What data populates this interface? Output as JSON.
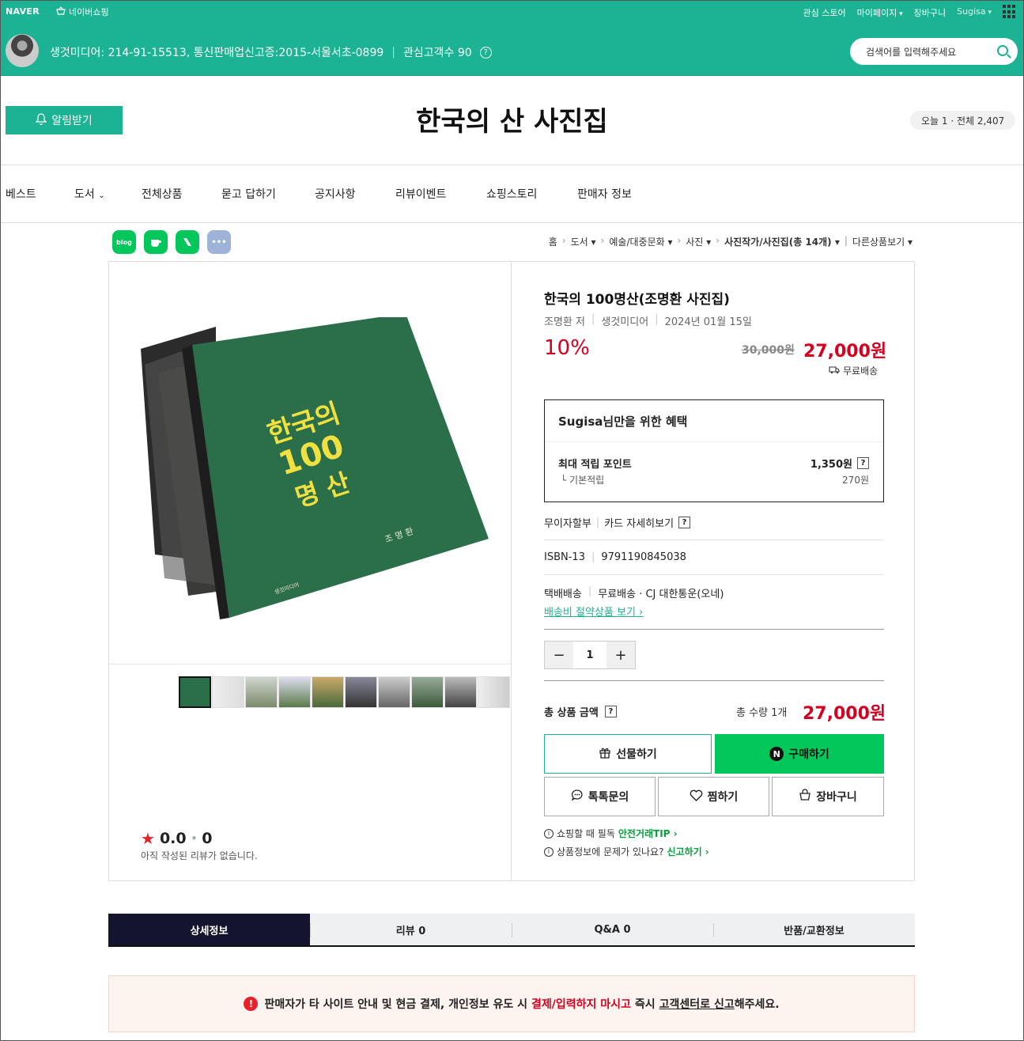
{
  "topbar": {
    "logo": "NAVER",
    "shopping": "네이버쇼핑",
    "links": [
      "관심 스토어",
      "마이페이지",
      "장바구니",
      "Sugisa"
    ],
    "seller_info": "생것미디어: 214-91-15513, 통신판매업신고증:2015-서울서초-0899",
    "followers": "관심고객수 90",
    "search_placeholder": "검색어를 입력해주세요"
  },
  "header": {
    "alarm_button": "알림받기",
    "store_title": "한국의 산 사진집",
    "visitors": "오늘 1 · 전체 2,407"
  },
  "nav": [
    "베스트",
    "도서",
    "전체상품",
    "묻고 답하기",
    "공지사항",
    "리뷰이벤트",
    "쇼핑스토리",
    "판매자 정보"
  ],
  "share": [
    "blog"
  ],
  "breadcrumb": [
    "홈",
    "도서",
    "예술/대중문화",
    "사진",
    "사진작가/사진집(총 14개)",
    "다른상품보기"
  ],
  "product": {
    "title": "한국의 100명산(조명환 사진집)",
    "author": "조명환 저",
    "publisher": "생것미디어",
    "date": "2024년 01월 15일",
    "discount": "10%",
    "original_price": "30,000원",
    "sale_price": "27,000원",
    "shipping_badge": "무료배송",
    "cover_title_1": "한국의",
    "cover_title_2": "100",
    "cover_title_3": "명 산",
    "cover_author": "조 명 환",
    "cover_publisher": "생것미디어"
  },
  "benefit": {
    "user": "Sugisa",
    "heading_suffix": "님만을 위한 혜택",
    "max_point_label": "최대 적립 포인트",
    "max_point_value": "1,350원",
    "base_label": "기본적립",
    "base_value": "270원"
  },
  "installment": {
    "label": "무이자할부",
    "card_link": "카드 자세히보기"
  },
  "isbn": {
    "label": "ISBN-13",
    "value": "9791190845038"
  },
  "shipping": {
    "label": "택배배송",
    "value": "무료배송 · CJ 대한통운(오네)",
    "link": "배송비 절약상품 보기"
  },
  "quantity": {
    "value": "1"
  },
  "total": {
    "label": "총 상품 금액",
    "qty": "총 수량 1개",
    "price": "27,000원"
  },
  "buttons": {
    "gift": "선물하기",
    "buy": "구매하기",
    "talk": "톡톡문의",
    "zzim": "찜하기",
    "cart": "장바구니"
  },
  "notices": {
    "tip_text": "쇼핑할 때 필독",
    "tip_link": "안전거래TIP",
    "report_text": "상품정보에 문제가 있나요?",
    "report_link": "신고하기"
  },
  "rating": {
    "score": "0.0",
    "count": "0",
    "empty_text": "아직 작성된 리뷰가 없습니다."
  },
  "tabs": [
    "상세정보",
    "리뷰 0",
    "Q&A 0",
    "반품/교환정보"
  ],
  "warning": {
    "part1": "판매자가 타 사이트 안내 및 현금 결제, 개인정보 유도 시",
    "part2": "결제/입력하지 마시고",
    "part3": "즉시",
    "part4": "고객센터로 신고",
    "part5": "해주세요."
  },
  "colors": {
    "brand": "#1bb394",
    "price_red": "#d4001f",
    "buy_green": "#03c75a"
  }
}
